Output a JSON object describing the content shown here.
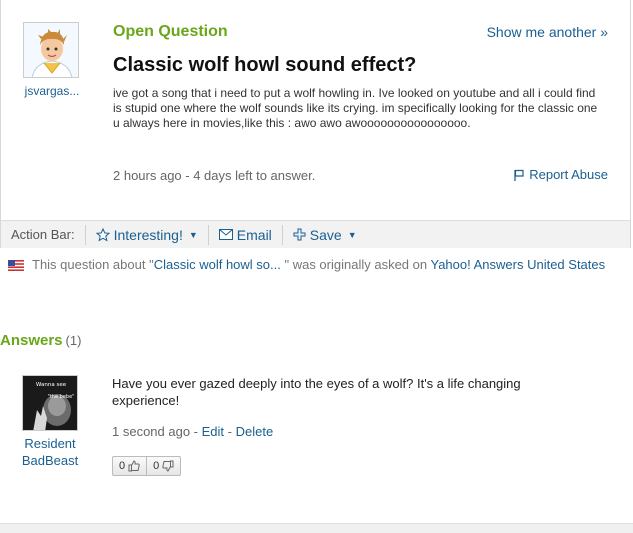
{
  "question": {
    "kind": "Open Question",
    "show_another": "Show me another »",
    "asker_name": "jsvargas...",
    "title": "Classic wolf howl sound effect?",
    "body": "ive got a song that i need to put a wolf howling in. Ive looked on youtube and all i could find is stupid one where the wolf sounds like its crying. im specifically looking for the classic one u always here in movies,like this : awo awo awoooooooooooooooo.",
    "meta": "2 hours ago - 4 days left to answer.",
    "report": "Report Abuse"
  },
  "action_bar": {
    "label": "Action Bar:",
    "interesting": "Interesting!",
    "email": "Email",
    "save": "Save"
  },
  "notice": {
    "prefix": "This question about \"",
    "question_link": "Classic wolf howl so...",
    "middle": " \" was originally asked on ",
    "site_link": "Yahoo! Answers United States"
  },
  "answers": {
    "heading": "Answers",
    "count": "(1)",
    "items": [
      {
        "author": "Resident BadBeast",
        "avatar_text_top": "Wanna see",
        "avatar_text_mid": "\"the bebe\"",
        "body": "Have you ever gazed deeply into the eyes of a wolf? It's a life changing experience!",
        "time": "1 second ago - ",
        "edit": "Edit",
        "sep": " - ",
        "delete": "Delete",
        "thumbs_up": "0",
        "thumbs_down": "0"
      }
    ]
  },
  "colors": {
    "accent_green": "#6aa61a",
    "link_blue": "#1b5f91"
  }
}
